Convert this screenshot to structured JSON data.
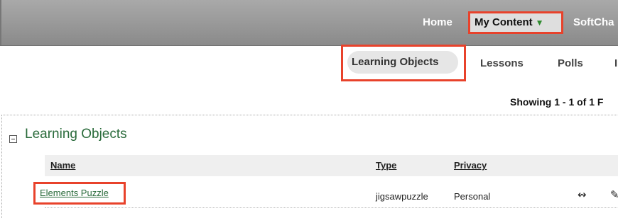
{
  "top_nav": {
    "home": "Home",
    "my_content": "My Content",
    "my_content_arrow": "▼",
    "softchalk": "SoftCha"
  },
  "sub_nav": {
    "items": [
      {
        "label": "Learning Objects"
      },
      {
        "label": "Lessons"
      },
      {
        "label": "Polls"
      },
      {
        "label": "I"
      }
    ]
  },
  "showing": "Showing 1 - 1 of 1 F",
  "section": {
    "title": "Learning Objects",
    "columns": {
      "name": "Name",
      "type": "Type",
      "privacy": "Privacy"
    },
    "rows": [
      {
        "name": "Elements Puzzle",
        "type": "jigsawpuzzle",
        "privacy": "Personal",
        "icons": [
          "share-arrows-icon",
          "pencil-edit-icon"
        ]
      }
    ]
  },
  "colors": {
    "highlight": "#e8422b",
    "green_text": "#2a6b3b",
    "nav_gray": "#999999"
  }
}
